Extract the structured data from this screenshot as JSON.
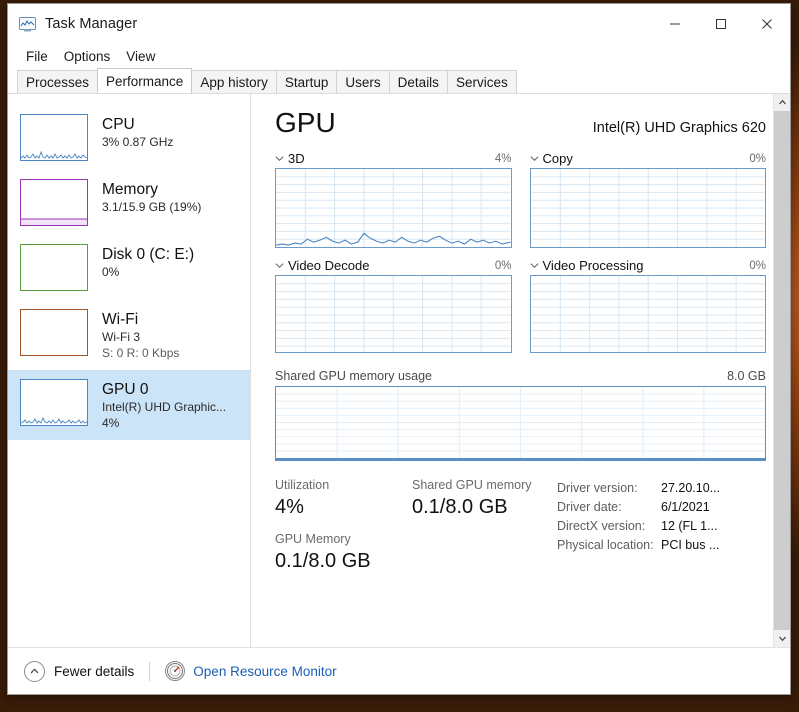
{
  "window": {
    "title": "Task Manager",
    "icon": "task-manager-icon",
    "buttons": {
      "minimize": "─",
      "maximize": "□",
      "close": "✕"
    }
  },
  "menu": {
    "items": [
      "File",
      "Options",
      "View"
    ]
  },
  "tabs": {
    "items": [
      "Processes",
      "Performance",
      "App history",
      "Startup",
      "Users",
      "Details",
      "Services"
    ],
    "active": "Performance"
  },
  "sidebar": {
    "items": [
      {
        "name": "CPU",
        "line1": "3%  0.87 GHz",
        "line2": "",
        "color": "#4a87c4",
        "selected": false
      },
      {
        "name": "Memory",
        "line1": "3.1/15.9 GB (19%)",
        "line2": "",
        "color": "#9a33b5",
        "selected": false
      },
      {
        "name": "Disk 0 (C: E:)",
        "line1": "0%",
        "line2": "",
        "color": "#5a9e3e",
        "selected": false
      },
      {
        "name": "Wi-Fi",
        "line1": "Wi-Fi 3",
        "line2": "S: 0  R: 0 Kbps",
        "color": "#a65226",
        "selected": false
      },
      {
        "name": "GPU 0",
        "line1": "Intel(R) UHD Graphic...",
        "line2": "4%",
        "color": "#4a87c4",
        "selected": true
      }
    ]
  },
  "detail": {
    "title": "GPU",
    "device": "Intel(R) UHD Graphics 620",
    "engines": [
      {
        "label": "3D",
        "value": "4%"
      },
      {
        "label": "Copy",
        "value": "0%"
      },
      {
        "label": "Video Decode",
        "value": "0%"
      },
      {
        "label": "Video Processing",
        "value": "0%"
      }
    ],
    "shared_memory": {
      "label": "Shared GPU memory usage",
      "max": "8.0 GB"
    },
    "stats": [
      {
        "label": "Utilization",
        "value": "4%"
      },
      {
        "label": "Shared GPU memory",
        "value": "0.1/8.0 GB"
      },
      {
        "label": "GPU Memory",
        "value": "0.1/8.0 GB"
      }
    ],
    "info": [
      {
        "key": "Driver version:",
        "value": "27.20.10..."
      },
      {
        "key": "Driver date:",
        "value": "6/1/2021"
      },
      {
        "key": "DirectX version:",
        "value": "12 (FL 1..."
      },
      {
        "key": "Physical location:",
        "value": "PCI bus ..."
      }
    ]
  },
  "statusbar": {
    "fewer_details": "Fewer details",
    "resource_monitor": "Open Resource Monitor"
  },
  "colors": {
    "accent_blue": "#4a87c4",
    "link": "#1a5fb4",
    "selection": "#cce4f7",
    "graph_border": "#6b9bc9"
  }
}
